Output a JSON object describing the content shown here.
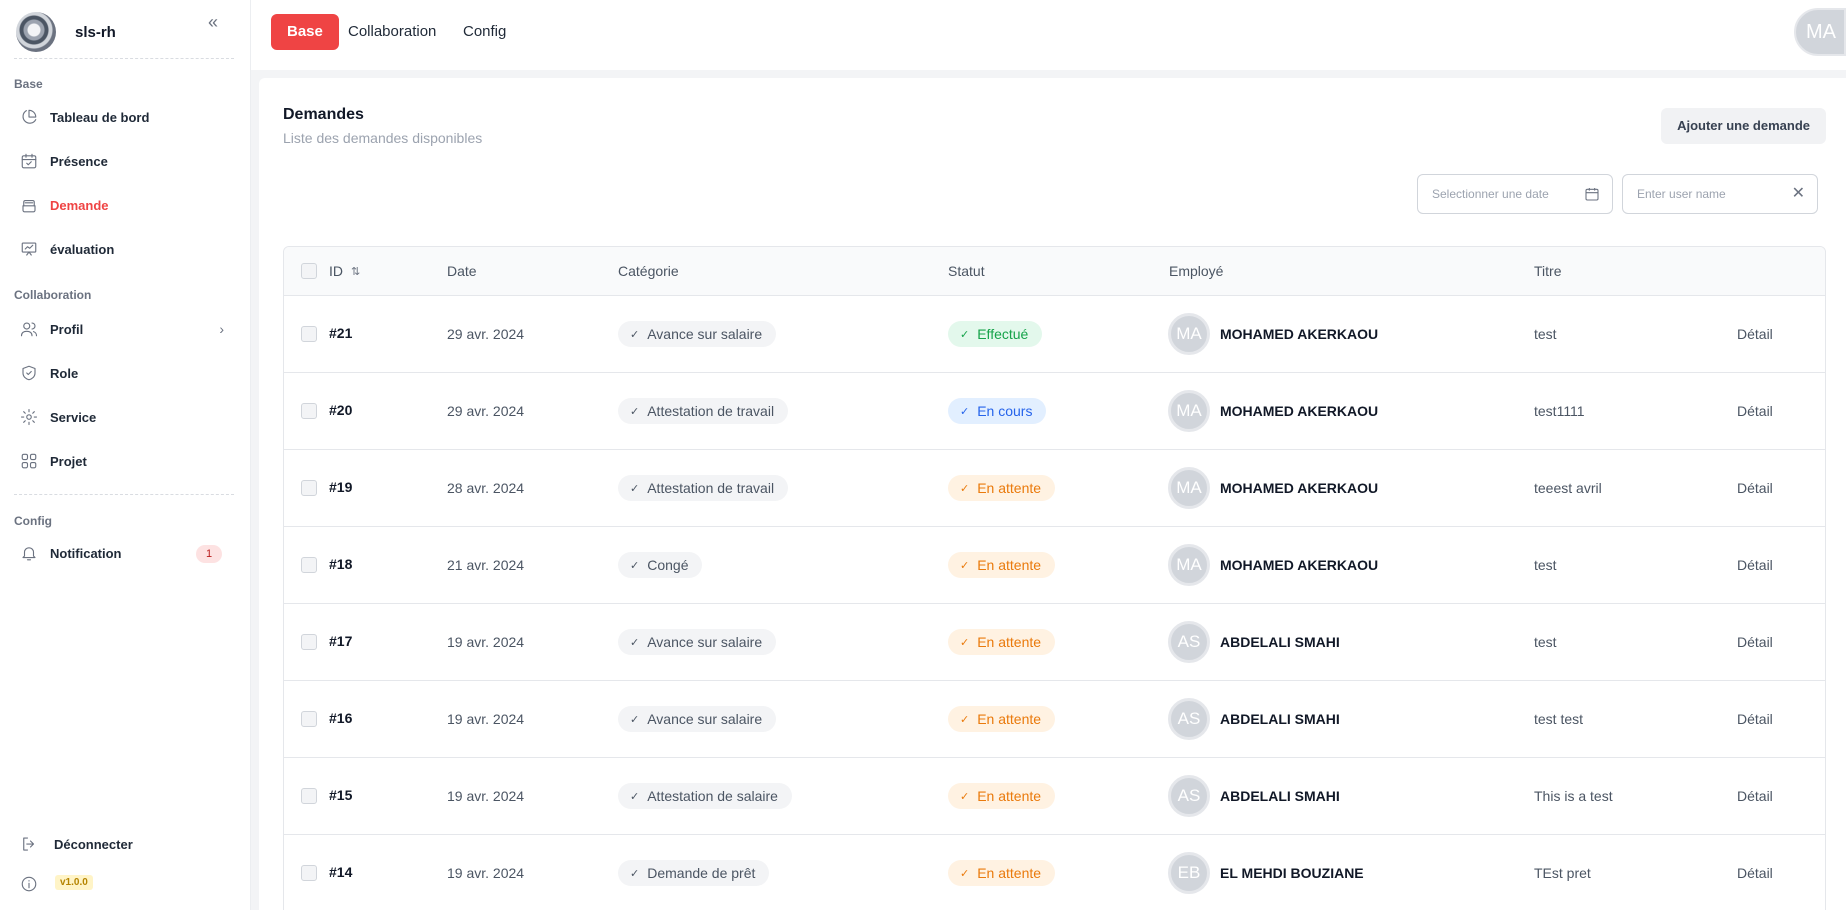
{
  "app": {
    "name": "sls-rh",
    "version": "v1.0.0"
  },
  "sidebar": {
    "sections": [
      {
        "label": "Base"
      },
      {
        "label": "Collaboration"
      },
      {
        "label": "Config"
      }
    ],
    "items": [
      {
        "label": "Tableau de bord",
        "icon": "pie-chart-icon"
      },
      {
        "label": "Présence",
        "icon": "calendar-icon"
      },
      {
        "label": "Demande",
        "icon": "inbox-icon",
        "active": true
      },
      {
        "label": "évaluation",
        "icon": "presentation-icon"
      },
      {
        "label": "Profil",
        "icon": "users-icon"
      },
      {
        "label": "Role",
        "icon": "shield-icon"
      },
      {
        "label": "Service",
        "icon": "gear-icon"
      },
      {
        "label": "Projet",
        "icon": "grid-icon"
      },
      {
        "label": "Notification",
        "icon": "bell-icon",
        "badge": "1"
      }
    ],
    "logout": "Déconnecter"
  },
  "topbar": {
    "tabs": [
      "Base",
      "Collaboration",
      "Config"
    ],
    "active_tab": "Base",
    "user_initials": "MA"
  },
  "page": {
    "title": "Demandes",
    "subtitle": "Liste des demandes disponibles",
    "add_button": "Ajouter une demande",
    "date_placeholder": "Selectionner une date",
    "name_placeholder": "Enter user name"
  },
  "table": {
    "headers": [
      "ID",
      "Date",
      "Catégorie",
      "Statut",
      "Employé",
      "Titre"
    ],
    "rows": [
      {
        "id": "#21",
        "date": "29 avr. 2024",
        "category": "Avance sur salaire",
        "status": "Effectué",
        "status_type": "done",
        "initials": "MA",
        "employee": "MOHAMED AKERKAOU",
        "title": "test",
        "action": "Détail"
      },
      {
        "id": "#20",
        "date": "29 avr. 2024",
        "category": "Attestation de travail",
        "status": "En cours",
        "status_type": "progress",
        "initials": "MA",
        "employee": "MOHAMED AKERKAOU",
        "title": "test1111",
        "action": "Détail"
      },
      {
        "id": "#19",
        "date": "28 avr. 2024",
        "category": "Attestation de travail",
        "status": "En attente",
        "status_type": "wait",
        "initials": "MA",
        "employee": "MOHAMED AKERKAOU",
        "title": "teeest avril",
        "action": "Détail"
      },
      {
        "id": "#18",
        "date": "21 avr. 2024",
        "category": "Congé",
        "status": "En attente",
        "status_type": "wait",
        "initials": "MA",
        "employee": "MOHAMED AKERKAOU",
        "title": "test",
        "action": "Détail"
      },
      {
        "id": "#17",
        "date": "19 avr. 2024",
        "category": "Avance sur salaire",
        "status": "En attente",
        "status_type": "wait",
        "initials": "AS",
        "employee": "ABDELALI SMAHI",
        "title": "test",
        "action": "Détail"
      },
      {
        "id": "#16",
        "date": "19 avr. 2024",
        "category": "Avance sur salaire",
        "status": "En attente",
        "status_type": "wait",
        "initials": "AS",
        "employee": "ABDELALI SMAHI",
        "title": "test test",
        "action": "Détail"
      },
      {
        "id": "#15",
        "date": "19 avr. 2024",
        "category": "Attestation de salaire",
        "status": "En attente",
        "status_type": "wait",
        "initials": "AS",
        "employee": "ABDELALI SMAHI",
        "title": "This is a test",
        "action": "Détail"
      },
      {
        "id": "#14",
        "date": "19 avr. 2024",
        "category": "Demande de prêt",
        "status": "En attente",
        "status_type": "wait",
        "initials": "EB",
        "employee": "EL MEHDI BOUZIANE",
        "title": "TEst pret",
        "action": "Détail"
      }
    ]
  },
  "colors": {
    "accent": "#ef4444",
    "done": "#16a34a",
    "progress": "#2563eb",
    "wait": "#ea7a0c"
  }
}
